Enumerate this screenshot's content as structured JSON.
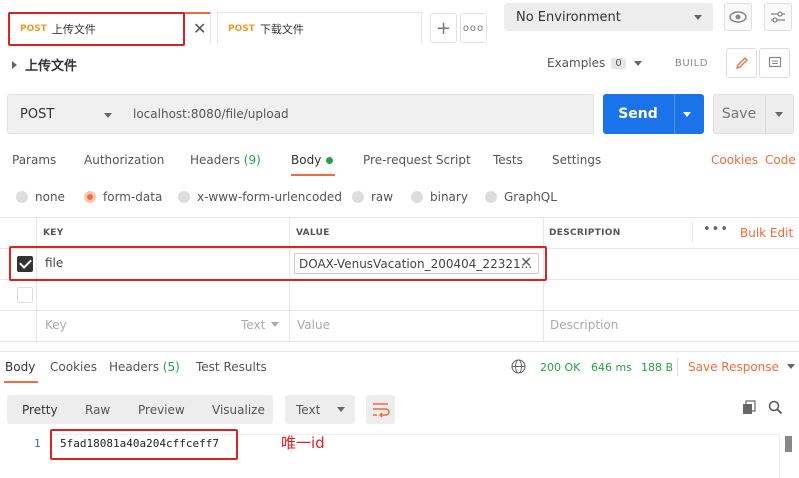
{
  "tabs": [
    {
      "method": "POST",
      "name": "上传文件",
      "active": true
    },
    {
      "method": "POST",
      "name": "下载文件",
      "active": false
    }
  ],
  "environment": {
    "selected": "No Environment"
  },
  "request": {
    "title": "上传文件",
    "examples_label": "Examples",
    "examples_count": "0",
    "build_label": "BUILD",
    "method": "POST",
    "url": "localhost:8080/file/upload",
    "send_label": "Send",
    "save_label": "Save"
  },
  "request_tabs": {
    "params": "Params",
    "authorization": "Authorization",
    "headers": "Headers",
    "headers_count": "(9)",
    "body": "Body",
    "prerequest": "Pre-request Script",
    "tests": "Tests",
    "settings": "Settings",
    "cookies": "Cookies",
    "code": "Code"
  },
  "body_types": [
    "none",
    "form-data",
    "x-www-form-urlencoded",
    "raw",
    "binary",
    "GraphQL"
  ],
  "body_type_selected": "form-data",
  "form_table": {
    "headers": {
      "key": "KEY",
      "value": "VALUE",
      "description": "DESCRIPTION",
      "bulk_edit": "Bulk Edit"
    },
    "row": {
      "key": "file",
      "value": "DOAX-VenusVacation_200404_22321...",
      "checked": true
    },
    "placeholder": {
      "key": "Key",
      "type": "Text",
      "value": "Value",
      "description": "Description"
    }
  },
  "response": {
    "tabs": {
      "body": "Body",
      "cookies": "Cookies",
      "headers": "Headers",
      "headers_count": "(5)",
      "test_results": "Test Results"
    },
    "status": "200 OK",
    "time": "646 ms",
    "size": "188 B",
    "save_response": "Save Response",
    "formats": [
      "Pretty",
      "Raw",
      "Preview",
      "Visualize"
    ],
    "text_type": "Text",
    "line_number": "1",
    "body_text": "5fad18081a40a204cffceff7",
    "annotation": "唯一id"
  },
  "colors": {
    "accent": "#f26b3a",
    "send": "#1a73e8",
    "success": "#27a243",
    "highlight": "#e02020"
  }
}
